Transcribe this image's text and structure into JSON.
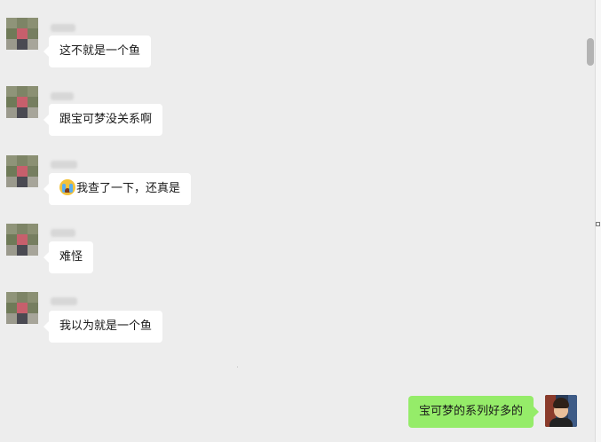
{
  "messages": [
    {
      "direction": "in",
      "text": "这不就是一个鱼"
    },
    {
      "direction": "in",
      "text": "跟宝可梦没关系啊"
    },
    {
      "direction": "in",
      "emoji": "loudly-crying-face-emoji",
      "text": "我查了一下，还真是"
    },
    {
      "direction": "in",
      "text": "难怪"
    },
    {
      "direction": "in",
      "text": "我以为就是一个鱼"
    },
    {
      "direction": "out",
      "text": "宝可梦的系列好多的"
    }
  ],
  "colors": {
    "chat_background": "#ededed",
    "incoming_bubble": "#ffffff",
    "outgoing_bubble": "#95ec69",
    "text": "#1a1a1a"
  }
}
